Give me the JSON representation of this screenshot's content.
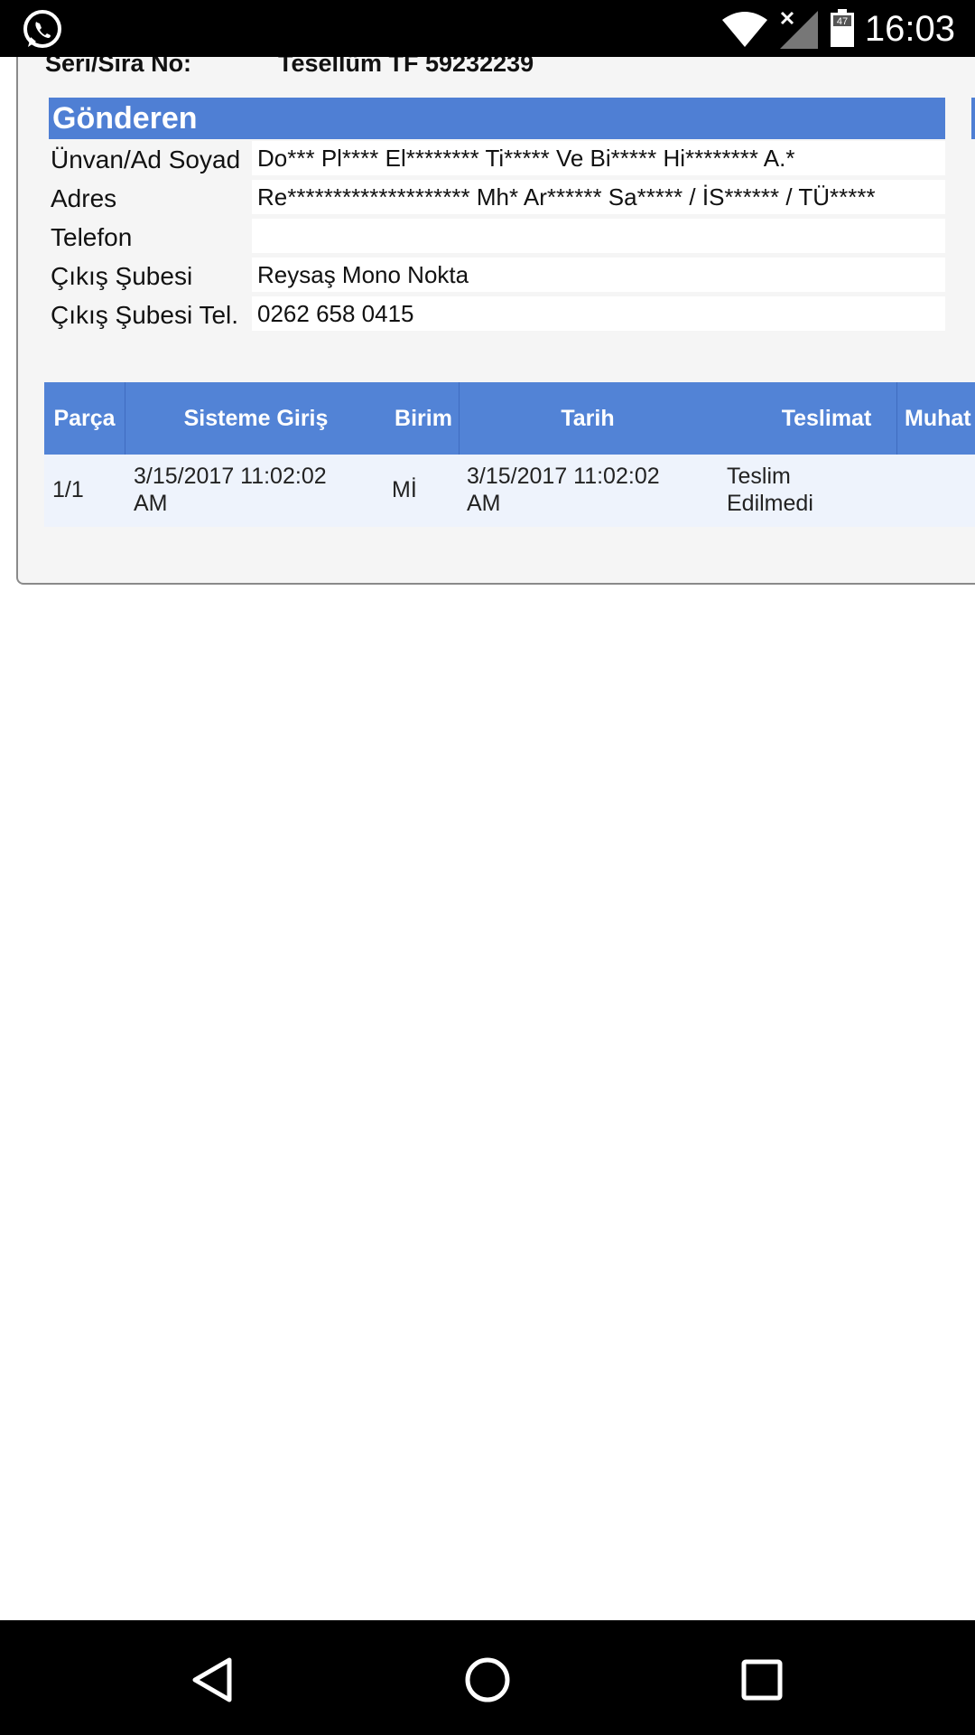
{
  "status_bar": {
    "time": "16:03",
    "battery_level": "47",
    "icons": [
      "whatsapp-icon",
      "wifi-icon",
      "signal-icon",
      "battery-icon"
    ]
  },
  "header": {
    "seri_label": "Seri/Sıra No:",
    "seri_value": "Tesellüm TF 59232239"
  },
  "sender": {
    "title": "Gönderen",
    "rows": [
      {
        "label": "Ünvan/Ad Soyad",
        "value": "Do*** Pl**** El******** Ti***** Ve Bi***** Hi******** A.*"
      },
      {
        "label": "Adres",
        "value": "Re******************** Mh* Ar****** Sa***** / İS****** / TÜ*****"
      },
      {
        "label": "Telefon",
        "value": ""
      },
      {
        "label": "Çıkış Şubesi",
        "value": "Reysaş Mono Nokta"
      },
      {
        "label": "Çıkış Şubesi Tel.",
        "value": "0262 658 0415"
      }
    ]
  },
  "grid": {
    "headers": [
      "Parça",
      "Sisteme Giriş",
      "Birim",
      "Tarih",
      "Teslimat",
      "Muhat"
    ],
    "rows": [
      {
        "parca": "1/1",
        "sisteme_giris": [
          "3/15/2017 11:02:02",
          "AM"
        ],
        "birim": "Mİ",
        "tarih": [
          "3/15/2017 11:02:02",
          "AM"
        ],
        "teslimat": [
          "Teslim",
          "Edilmedi"
        ],
        "muhat": ""
      }
    ]
  },
  "nav_bar": {
    "icons": [
      "back-icon",
      "home-icon",
      "recents-icon"
    ]
  },
  "colors": {
    "accent": "#5283d6",
    "row_background": "#eef3fc",
    "panel_background": "#f5f5f5"
  }
}
